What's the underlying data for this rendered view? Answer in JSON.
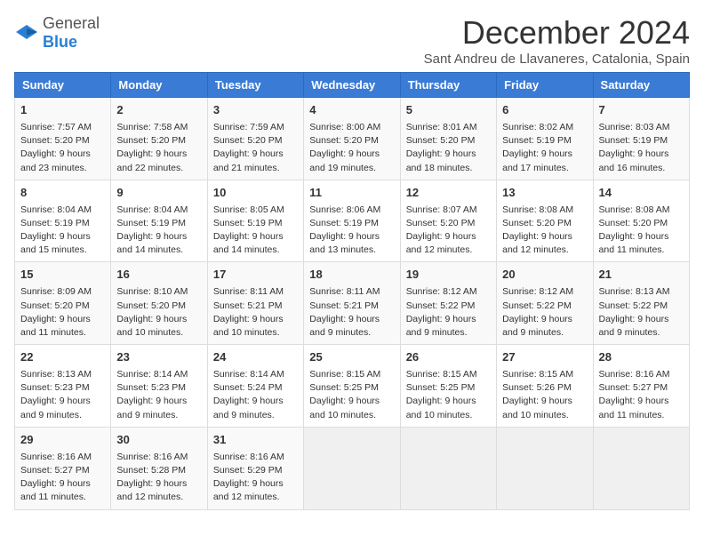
{
  "header": {
    "logo_general": "General",
    "logo_blue": "Blue",
    "month_title": "December 2024",
    "location": "Sant Andreu de Llavaneres, Catalonia, Spain"
  },
  "days_of_week": [
    "Sunday",
    "Monday",
    "Tuesday",
    "Wednesday",
    "Thursday",
    "Friday",
    "Saturday"
  ],
  "weeks": [
    [
      {
        "day": "1",
        "sunrise": "Sunrise: 7:57 AM",
        "sunset": "Sunset: 5:20 PM",
        "daylight": "Daylight: 9 hours and 23 minutes."
      },
      {
        "day": "2",
        "sunrise": "Sunrise: 7:58 AM",
        "sunset": "Sunset: 5:20 PM",
        "daylight": "Daylight: 9 hours and 22 minutes."
      },
      {
        "day": "3",
        "sunrise": "Sunrise: 7:59 AM",
        "sunset": "Sunset: 5:20 PM",
        "daylight": "Daylight: 9 hours and 21 minutes."
      },
      {
        "day": "4",
        "sunrise": "Sunrise: 8:00 AM",
        "sunset": "Sunset: 5:20 PM",
        "daylight": "Daylight: 9 hours and 19 minutes."
      },
      {
        "day": "5",
        "sunrise": "Sunrise: 8:01 AM",
        "sunset": "Sunset: 5:20 PM",
        "daylight": "Daylight: 9 hours and 18 minutes."
      },
      {
        "day": "6",
        "sunrise": "Sunrise: 8:02 AM",
        "sunset": "Sunset: 5:19 PM",
        "daylight": "Daylight: 9 hours and 17 minutes."
      },
      {
        "day": "7",
        "sunrise": "Sunrise: 8:03 AM",
        "sunset": "Sunset: 5:19 PM",
        "daylight": "Daylight: 9 hours and 16 minutes."
      }
    ],
    [
      {
        "day": "8",
        "sunrise": "Sunrise: 8:04 AM",
        "sunset": "Sunset: 5:19 PM",
        "daylight": "Daylight: 9 hours and 15 minutes."
      },
      {
        "day": "9",
        "sunrise": "Sunrise: 8:04 AM",
        "sunset": "Sunset: 5:19 PM",
        "daylight": "Daylight: 9 hours and 14 minutes."
      },
      {
        "day": "10",
        "sunrise": "Sunrise: 8:05 AM",
        "sunset": "Sunset: 5:19 PM",
        "daylight": "Daylight: 9 hours and 14 minutes."
      },
      {
        "day": "11",
        "sunrise": "Sunrise: 8:06 AM",
        "sunset": "Sunset: 5:19 PM",
        "daylight": "Daylight: 9 hours and 13 minutes."
      },
      {
        "day": "12",
        "sunrise": "Sunrise: 8:07 AM",
        "sunset": "Sunset: 5:20 PM",
        "daylight": "Daylight: 9 hours and 12 minutes."
      },
      {
        "day": "13",
        "sunrise": "Sunrise: 8:08 AM",
        "sunset": "Sunset: 5:20 PM",
        "daylight": "Daylight: 9 hours and 12 minutes."
      },
      {
        "day": "14",
        "sunrise": "Sunrise: 8:08 AM",
        "sunset": "Sunset: 5:20 PM",
        "daylight": "Daylight: 9 hours and 11 minutes."
      }
    ],
    [
      {
        "day": "15",
        "sunrise": "Sunrise: 8:09 AM",
        "sunset": "Sunset: 5:20 PM",
        "daylight": "Daylight: 9 hours and 11 minutes."
      },
      {
        "day": "16",
        "sunrise": "Sunrise: 8:10 AM",
        "sunset": "Sunset: 5:20 PM",
        "daylight": "Daylight: 9 hours and 10 minutes."
      },
      {
        "day": "17",
        "sunrise": "Sunrise: 8:11 AM",
        "sunset": "Sunset: 5:21 PM",
        "daylight": "Daylight: 9 hours and 10 minutes."
      },
      {
        "day": "18",
        "sunrise": "Sunrise: 8:11 AM",
        "sunset": "Sunset: 5:21 PM",
        "daylight": "Daylight: 9 hours and 9 minutes."
      },
      {
        "day": "19",
        "sunrise": "Sunrise: 8:12 AM",
        "sunset": "Sunset: 5:22 PM",
        "daylight": "Daylight: 9 hours and 9 minutes."
      },
      {
        "day": "20",
        "sunrise": "Sunrise: 8:12 AM",
        "sunset": "Sunset: 5:22 PM",
        "daylight": "Daylight: 9 hours and 9 minutes."
      },
      {
        "day": "21",
        "sunrise": "Sunrise: 8:13 AM",
        "sunset": "Sunset: 5:22 PM",
        "daylight": "Daylight: 9 hours and 9 minutes."
      }
    ],
    [
      {
        "day": "22",
        "sunrise": "Sunrise: 8:13 AM",
        "sunset": "Sunset: 5:23 PM",
        "daylight": "Daylight: 9 hours and 9 minutes."
      },
      {
        "day": "23",
        "sunrise": "Sunrise: 8:14 AM",
        "sunset": "Sunset: 5:23 PM",
        "daylight": "Daylight: 9 hours and 9 minutes."
      },
      {
        "day": "24",
        "sunrise": "Sunrise: 8:14 AM",
        "sunset": "Sunset: 5:24 PM",
        "daylight": "Daylight: 9 hours and 9 minutes."
      },
      {
        "day": "25",
        "sunrise": "Sunrise: 8:15 AM",
        "sunset": "Sunset: 5:25 PM",
        "daylight": "Daylight: 9 hours and 10 minutes."
      },
      {
        "day": "26",
        "sunrise": "Sunrise: 8:15 AM",
        "sunset": "Sunset: 5:25 PM",
        "daylight": "Daylight: 9 hours and 10 minutes."
      },
      {
        "day": "27",
        "sunrise": "Sunrise: 8:15 AM",
        "sunset": "Sunset: 5:26 PM",
        "daylight": "Daylight: 9 hours and 10 minutes."
      },
      {
        "day": "28",
        "sunrise": "Sunrise: 8:16 AM",
        "sunset": "Sunset: 5:27 PM",
        "daylight": "Daylight: 9 hours and 11 minutes."
      }
    ],
    [
      {
        "day": "29",
        "sunrise": "Sunrise: 8:16 AM",
        "sunset": "Sunset: 5:27 PM",
        "daylight": "Daylight: 9 hours and 11 minutes."
      },
      {
        "day": "30",
        "sunrise": "Sunrise: 8:16 AM",
        "sunset": "Sunset: 5:28 PM",
        "daylight": "Daylight: 9 hours and 12 minutes."
      },
      {
        "day": "31",
        "sunrise": "Sunrise: 8:16 AM",
        "sunset": "Sunset: 5:29 PM",
        "daylight": "Daylight: 9 hours and 12 minutes."
      },
      null,
      null,
      null,
      null
    ]
  ]
}
